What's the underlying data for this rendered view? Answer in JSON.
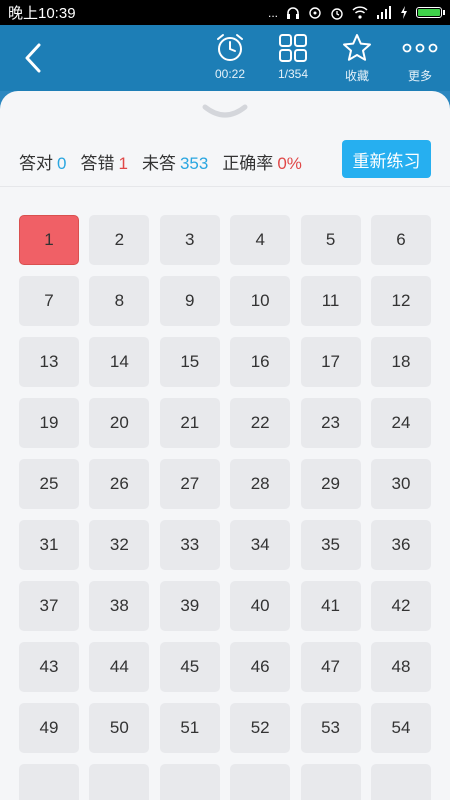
{
  "status_bar": {
    "time": "晚上10:39",
    "dots": "...",
    "battery_color": "#3fd24a"
  },
  "toolbar": {
    "timer_label": "00:22",
    "progress_label": "1/354",
    "favorite_label": "收藏",
    "more_label": "更多",
    "accent_color": "#1d7eb6"
  },
  "stats": {
    "correct_label": "答对",
    "correct_value": "0",
    "wrong_label": "答错",
    "wrong_value": "1",
    "unanswered_label": "未答",
    "unanswered_value": "353",
    "accuracy_label": "正确率",
    "accuracy_value": "0%"
  },
  "restart_label": "重新练习",
  "questions": [
    {
      "n": "1",
      "state": "wrong"
    },
    {
      "n": "2"
    },
    {
      "n": "3"
    },
    {
      "n": "4"
    },
    {
      "n": "5"
    },
    {
      "n": "6"
    },
    {
      "n": "7"
    },
    {
      "n": "8"
    },
    {
      "n": "9"
    },
    {
      "n": "10"
    },
    {
      "n": "11"
    },
    {
      "n": "12"
    },
    {
      "n": "13"
    },
    {
      "n": "14"
    },
    {
      "n": "15"
    },
    {
      "n": "16"
    },
    {
      "n": "17"
    },
    {
      "n": "18"
    },
    {
      "n": "19"
    },
    {
      "n": "20"
    },
    {
      "n": "21"
    },
    {
      "n": "22"
    },
    {
      "n": "23"
    },
    {
      "n": "24"
    },
    {
      "n": "25"
    },
    {
      "n": "26"
    },
    {
      "n": "27"
    },
    {
      "n": "28"
    },
    {
      "n": "29"
    },
    {
      "n": "30"
    },
    {
      "n": "31"
    },
    {
      "n": "32"
    },
    {
      "n": "33"
    },
    {
      "n": "34"
    },
    {
      "n": "35"
    },
    {
      "n": "36"
    },
    {
      "n": "37"
    },
    {
      "n": "38"
    },
    {
      "n": "39"
    },
    {
      "n": "40"
    },
    {
      "n": "41"
    },
    {
      "n": "42"
    },
    {
      "n": "43"
    },
    {
      "n": "44"
    },
    {
      "n": "45"
    },
    {
      "n": "46"
    },
    {
      "n": "47"
    },
    {
      "n": "48"
    },
    {
      "n": "49"
    },
    {
      "n": "50"
    },
    {
      "n": "51"
    },
    {
      "n": "52"
    },
    {
      "n": "53"
    },
    {
      "n": "54"
    },
    {
      "n": ""
    },
    {
      "n": ""
    },
    {
      "n": ""
    },
    {
      "n": ""
    },
    {
      "n": ""
    },
    {
      "n": ""
    }
  ]
}
